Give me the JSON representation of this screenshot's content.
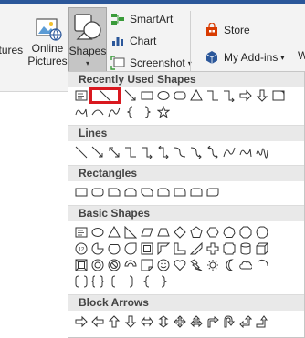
{
  "ribbon": {
    "pictures_label": "Pictures",
    "online_pictures_label_1": "Online",
    "online_pictures_label_2": "Pictures",
    "shapes_label": "Shapes",
    "shapes_caret": "▾",
    "smartart_label": "SmartArt",
    "chart_label": "Chart",
    "screenshot_label": "Screenshot",
    "screenshot_caret": "▾",
    "store_label": "Store",
    "addins_label": "My Add-ins",
    "addins_caret": "▾",
    "cut_label": "W",
    "colors": {
      "store": "#d83b01",
      "addins": "#2b579a",
      "chart": "#2b579a",
      "smartart": "#3a9b3a",
      "highlight": "#d9181f"
    }
  },
  "gallery": {
    "sections": [
      {
        "title": "Recently Used Shapes"
      },
      {
        "title": "Lines"
      },
      {
        "title": "Rectangles"
      },
      {
        "title": "Basic Shapes"
      },
      {
        "title": "Block Arrows"
      }
    ],
    "recently_used": {
      "row1": [
        "text-box",
        "line",
        "arrow-line",
        "rectangle",
        "oval",
        "rounded-rectangle",
        "triangle",
        "elbow-connector",
        "elbow-arrow-connector",
        "right-arrow",
        "down-arrow",
        "flowchart-process"
      ],
      "row2": [
        "freeform",
        "curved-arc",
        "curve",
        "left-brace",
        "right-brace",
        "star-5"
      ],
      "selected": "line"
    },
    "lines": [
      "line",
      "arrow-line",
      "double-arrow-line",
      "elbow-connector",
      "elbow-arrow",
      "elbow-double-arrow",
      "curved-connector",
      "curved-arrow-connector",
      "curved-double-arrow",
      "curve",
      "freeform",
      "scribble"
    ],
    "rectangles": [
      "rectangle",
      "rounded-rectangle",
      "snip-single-corner",
      "snip-same-side",
      "snip-diagonal",
      "snip-round",
      "round-single-corner",
      "round-same-side",
      "round-diagonal"
    ],
    "basic_shapes": {
      "row1": [
        "text-box",
        "oval",
        "triangle",
        "right-triangle",
        "parallelogram",
        "trapezoid",
        "diamond",
        "pentagon",
        "hexagon",
        "heptagon",
        "octagon",
        "decagon"
      ],
      "row2": [
        "dodecagon",
        "pie",
        "chord",
        "teardrop",
        "frame",
        "half-frame",
        "l-shape",
        "diagonal-stripe",
        "plus",
        "plaque",
        "can",
        "cube"
      ],
      "row3": [
        "bevel",
        "donut",
        "no-symbol",
        "block-arc",
        "folded-corner",
        "smiley",
        "heart",
        "lightning",
        "sun",
        "moon",
        "cloud",
        "arc"
      ],
      "row4": [
        "double-bracket",
        "double-brace",
        "left-bracket",
        "right-bracket",
        "left-brace",
        "right-brace"
      ]
    },
    "block_arrows": [
      "right-arrow",
      "left-arrow",
      "up-arrow",
      "down-arrow",
      "left-right-arrow",
      "up-down-arrow",
      "quad-arrow",
      "left-right-up-arrow",
      "bent-arrow",
      "u-turn-arrow",
      "left-up-arrow",
      "bent-up-arrow"
    ]
  }
}
